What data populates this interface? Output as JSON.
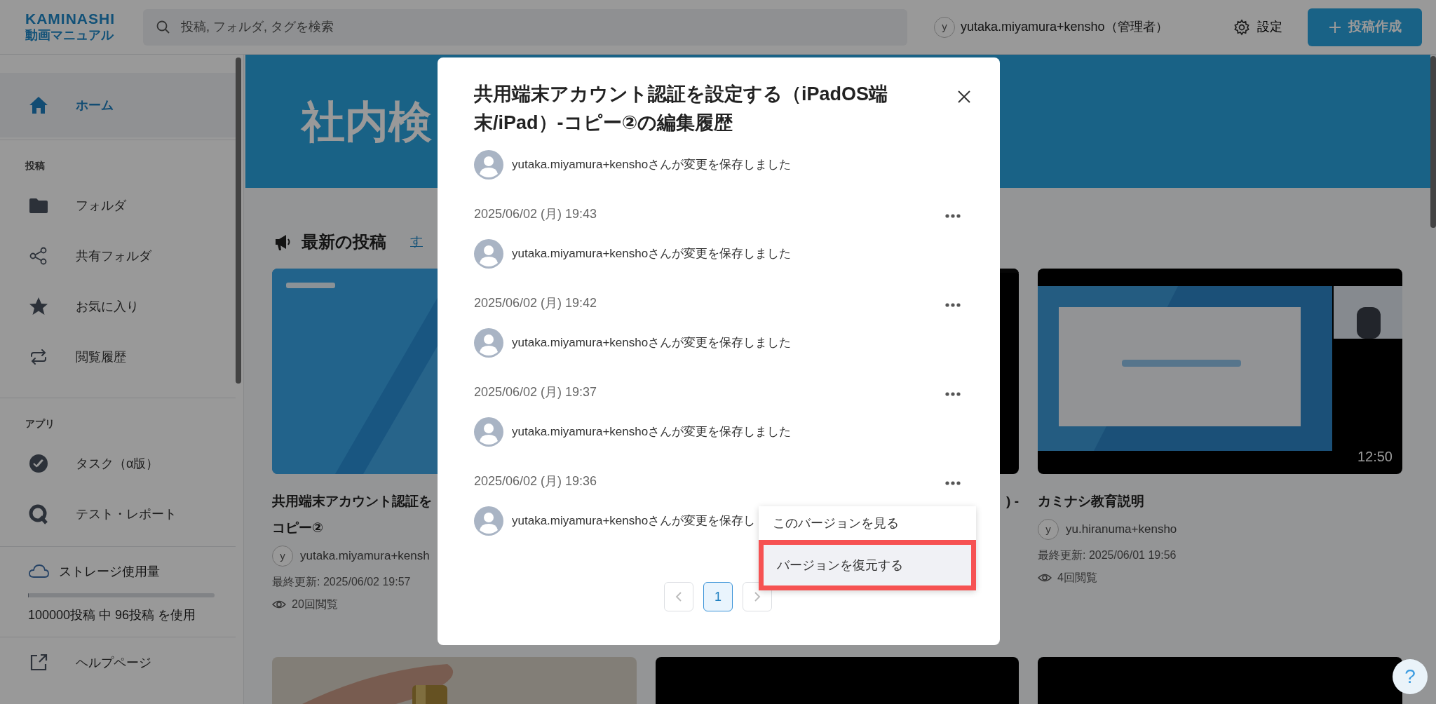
{
  "header": {
    "logo": {
      "line1": "KAMINASHI",
      "line2": "動画マニュアル"
    },
    "search": {
      "placeholder": "投稿, フォルダ, タグを検索"
    },
    "user": {
      "avatar": "y",
      "name": "yutaka.miyamura+kensho（管理者）"
    },
    "settings": "設定",
    "create_button": "投稿作成"
  },
  "sidebar": {
    "home": {
      "label": "ホーム",
      "selected": true
    },
    "groups": [
      {
        "heading": "投稿",
        "items": [
          {
            "label": "フォルダ",
            "selected": false
          },
          {
            "label": "共有フォルダ",
            "selected": false
          },
          {
            "label": "お気に入り",
            "selected": false
          },
          {
            "label": "閲覧履歴",
            "selected": false
          }
        ]
      },
      {
        "heading": "アプリ",
        "items": [
          {
            "label": "タスク（α版）",
            "selected": false
          },
          {
            "label": "テスト・レポート",
            "selected": false
          }
        ]
      }
    ],
    "storage": {
      "label": "ストレージ使用量",
      "level": 0.001,
      "usage": "100000投稿 中 96投稿 を使用"
    },
    "help": {
      "label": "ヘルプページ"
    }
  },
  "main": {
    "banner": {
      "title": "社内検"
    },
    "latest": {
      "heading": "最新の投稿",
      "link": "す",
      "cards": [
        {
          "kind": "picture",
          "title_lines": [
            "共用端末アカウント認証を",
            "コピー②"
          ],
          "avatar": "y",
          "author": "yutaka.miyamura+kensh",
          "updated": "最終更新: 2025/06/02 19:57",
          "views": "20回閲覧"
        },
        {
          "kind": "picture",
          "title_lines": [
            ") -"
          ]
        },
        {
          "kind": "picture",
          "duration": "12:50",
          "title_lines": [
            "カミナシ教育説明"
          ],
          "avatar": "y",
          "author": "yu.hiranuma+kensho",
          "updated": "最終更新: 2025/06/01 19:56",
          "views": "4回閲覧"
        }
      ]
    }
  },
  "modal": {
    "title": "共用端末アカウント認証を設定する（iPadOS端末/iPad）-コピー②の編集履歴",
    "history": [
      {
        "message": "yutaka.miyamura+kenshoさんが変更を保存しました"
      },
      {
        "date": "2025/06/02 (月) 19:43",
        "message": "yutaka.miyamura+kenshoさんが変更を保存しました"
      },
      {
        "date": "2025/06/02 (月) 19:42",
        "message": "yutaka.miyamura+kenshoさんが変更を保存しました"
      },
      {
        "date": "2025/06/02 (月) 19:37",
        "message": "yutaka.miyamura+kenshoさんが変更を保存しました"
      },
      {
        "date": "2025/06/02 (月) 19:36",
        "message": "yutaka.miyamura+kenshoさんが変更を保存し"
      }
    ],
    "menu": {
      "items": [
        {
          "label": "このバージョンを見る",
          "selected": false,
          "outlined": false
        },
        {
          "label": "バージョンを復元する",
          "selected": true,
          "outlined": true
        }
      ]
    },
    "pagination": {
      "prev_disabled": true,
      "pages": [
        {
          "label": "1",
          "selected": true
        }
      ],
      "next_disabled": true
    }
  },
  "help_button": "?"
}
